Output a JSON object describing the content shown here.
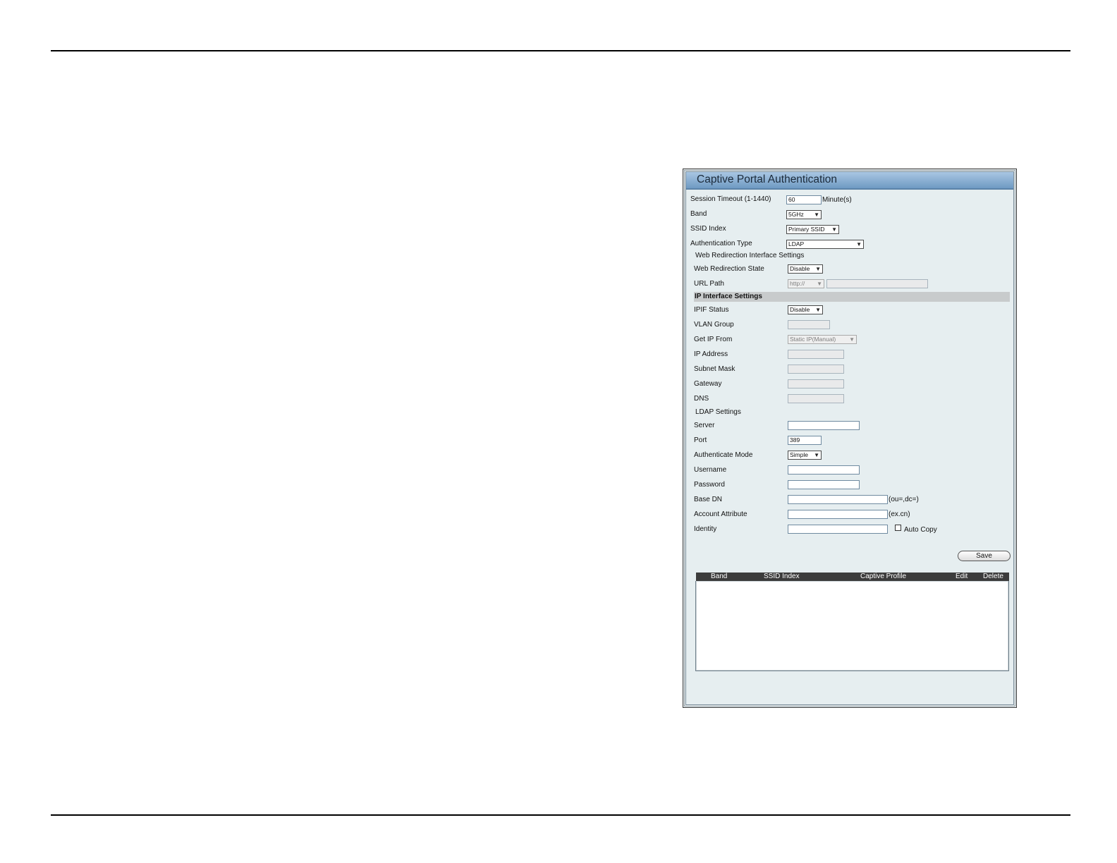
{
  "panel": {
    "title": "Captive Portal Authentication"
  },
  "form": {
    "session_timeout_label": "Session Timeout (1-1440)",
    "session_timeout_value": "60",
    "session_timeout_unit": "Minute(s)",
    "band_label": "Band",
    "band_value": "5GHz",
    "ssid_index_label": "SSID Index",
    "ssid_index_value": "Primary SSID",
    "auth_type_label": "Authentication Type",
    "auth_type_value": "LDAP"
  },
  "web_redirection": {
    "section_title": "Web Redirection Interface Settings",
    "state_label": "Web Redirection State",
    "state_value": "Disable",
    "url_path_label": "URL Path",
    "url_path_protocol": "http://",
    "url_path_value": ""
  },
  "ip_interface": {
    "section_title": "IP Interface Settings",
    "ipif_status_label": "IPIF Status",
    "ipif_status_value": "Disable",
    "vlan_group_label": "VLAN Group",
    "vlan_group_value": "",
    "get_ip_from_label": "Get IP From",
    "get_ip_from_value": "Static IP(Manual)",
    "ip_address_label": "IP Address",
    "subnet_mask_label": "Subnet Mask",
    "gateway_label": "Gateway",
    "dns_label": "DNS"
  },
  "ldap": {
    "section_title": "LDAP Settings",
    "server_label": "Server",
    "server_value": "",
    "port_label": "Port",
    "port_value": "389",
    "auth_mode_label": "Authenticate Mode",
    "auth_mode_value": "Simple",
    "username_label": "Username",
    "password_label": "Password",
    "base_dn_label": "Base DN",
    "base_dn_hint": "(ou=,dc=)",
    "account_attr_label": "Account Attribute",
    "account_attr_hint": "(ex.cn)",
    "identity_label": "Identity",
    "auto_copy_label": "Auto Copy"
  },
  "actions": {
    "save_label": "Save"
  },
  "table": {
    "headers": [
      "Band",
      "SSID Index",
      "Captive Profile",
      "Edit",
      "Delete"
    ],
    "rows": []
  }
}
